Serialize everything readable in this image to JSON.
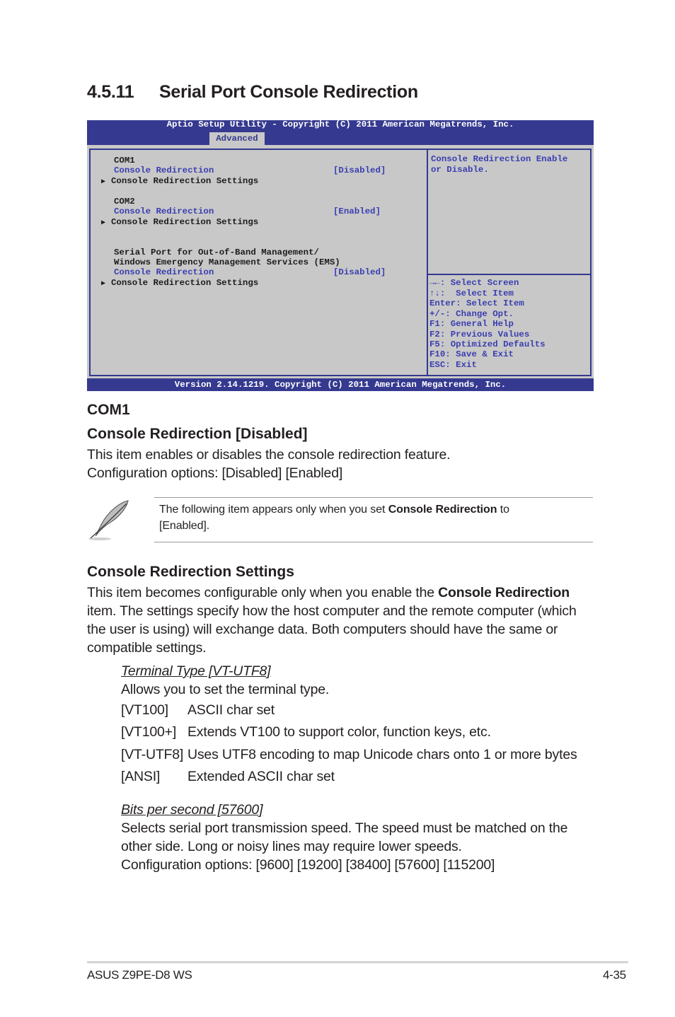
{
  "section": {
    "number": "4.5.11",
    "title": "Serial Port Console Redirection"
  },
  "bios": {
    "header_title": "Aptio Setup Utility - Copyright (C) 2011 American Megatrends, Inc.",
    "active_tab": "Advanced",
    "items": [
      {
        "type": "heading",
        "label": "COM1"
      },
      {
        "type": "option",
        "label": "Console Redirection",
        "value": "[Disabled]"
      },
      {
        "type": "submenu",
        "label": "Console Redirection Settings"
      },
      {
        "type": "heading",
        "label": "COM2"
      },
      {
        "type": "option",
        "label": "Console Redirection",
        "value": "[Enabled]"
      },
      {
        "type": "submenu",
        "label": "Console Redirection Settings"
      },
      {
        "type": "heading",
        "label": "Serial Port for Out-of-Band Management/"
      },
      {
        "type": "heading",
        "label": "Windows Emergency Management Services (EMS)"
      },
      {
        "type": "option",
        "label": "Console Redirection",
        "value": "[Disabled]"
      },
      {
        "type": "submenu",
        "label": "Console Redirection Settings"
      }
    ],
    "help_text": [
      "Console Redirection Enable",
      "or Disable."
    ],
    "key_help": [
      "→←: Select Screen",
      "↑↓:  Select Item",
      "Enter: Select Item",
      "+/-: Change Opt.",
      "F1: General Help",
      "F2: Previous Values",
      "F5: Optimized Defaults",
      "F10: Save & Exit",
      "ESC: Exit"
    ],
    "footer": "Version 2.14.1219. Copyright (C) 2011 American Megatrends, Inc.",
    "colors": {
      "header_bg": "#35398f",
      "panel_bg": "#c8c8c8",
      "option_text": "#3a3eb0"
    }
  },
  "com1": {
    "heading": "COM1",
    "subheading": "Console Redirection [Disabled]",
    "desc1": "This item enables or disables the console redirection feature.",
    "desc2": "Configuration options: [Disabled] [Enabled]"
  },
  "note": {
    "icon": "feather-pen-icon",
    "text_before": "The following item appears only when you set ",
    "text_bold": "Console Redirection",
    "text_after": " to",
    "text_line2": "[Enabled]."
  },
  "crs": {
    "heading": "Console Redirection Settings",
    "para_before": "This item becomes configurable only when you enable the ",
    "para_bold": "Console Redirection",
    "para_line2": "item. The settings specify how the host computer and the remote computer (which",
    "para_line3": "the user is using) will exchange data. Both computers should have the same or",
    "para_line4": "compatible settings."
  },
  "terminal_type": {
    "title": "Terminal Type [VT-UTF8]",
    "desc": "Allows you to set the terminal type.",
    "options": [
      {
        "key": "[VT100]",
        "desc": "ASCII char set"
      },
      {
        "key": "[VT100+]",
        "desc": "Extends VT100 to support color, function keys, etc."
      },
      {
        "key": "[VT-UTF8]",
        "desc": "Uses UTF8 encoding to map Unicode chars onto 1 or more bytes"
      },
      {
        "key": "[ANSI]",
        "desc": "Extended ASCII char set"
      }
    ]
  },
  "bits_per_second": {
    "title": "Bits per second [57600]",
    "line1": "Selects serial port transmission speed. The speed must be matched on the",
    "line2": "other side. Long or noisy lines may require lower speeds.",
    "line3": "Configuration options: [9600] [19200] [38400] [57600] [115200]"
  },
  "footer": {
    "product": "ASUS Z9PE-D8 WS",
    "page": "4-35"
  }
}
